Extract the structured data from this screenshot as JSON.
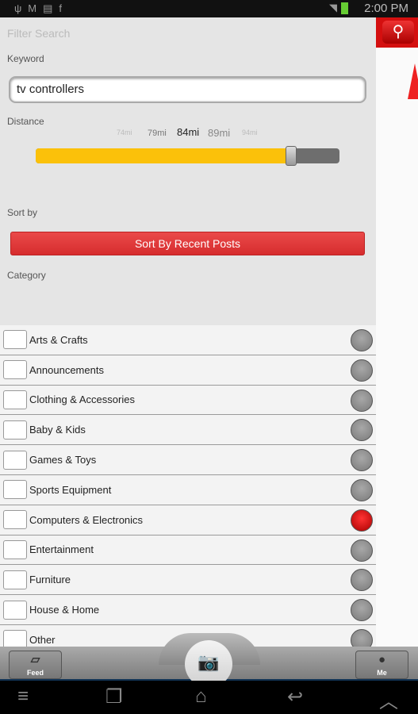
{
  "status_bar": {
    "time": "2:00 PM",
    "icons": [
      "usb-icon",
      "gmail-icon",
      "calendar-icon",
      "facebook-icon",
      "wifi-icon",
      "battery-icon"
    ]
  },
  "filter": {
    "title": "Filter Search",
    "keyword_label": "Keyword",
    "keyword_value": "tv controllers",
    "distance_label": "Distance",
    "distance_ticks": [
      "74mi",
      "79mi",
      "84mi",
      "89mi",
      "94mi"
    ],
    "distance_value_mi": 84,
    "distance_fill_percent": 84,
    "sort_label": "Sort by",
    "sort_button": "Sort By Recent Posts",
    "category_label": "Category"
  },
  "categories": [
    {
      "label": "Arts & Crafts",
      "selected": false
    },
    {
      "label": "Announcements",
      "selected": false
    },
    {
      "label": "Clothing & Accessories",
      "selected": false
    },
    {
      "label": "Baby & Kids",
      "selected": false
    },
    {
      "label": "Games & Toys",
      "selected": false
    },
    {
      "label": "Sports Equipment",
      "selected": false
    },
    {
      "label": "Computers & Electronics",
      "selected": true
    },
    {
      "label": "Entertainment",
      "selected": false
    },
    {
      "label": "Furniture",
      "selected": false
    },
    {
      "label": "House & Home",
      "selected": false
    },
    {
      "label": "Other",
      "selected": false
    }
  ],
  "tabbar": {
    "feed": "Feed",
    "me": "Me"
  },
  "colors": {
    "accent": "#d62c2e",
    "slider": "#fbc10a",
    "selected_radio": "#cc0000"
  }
}
